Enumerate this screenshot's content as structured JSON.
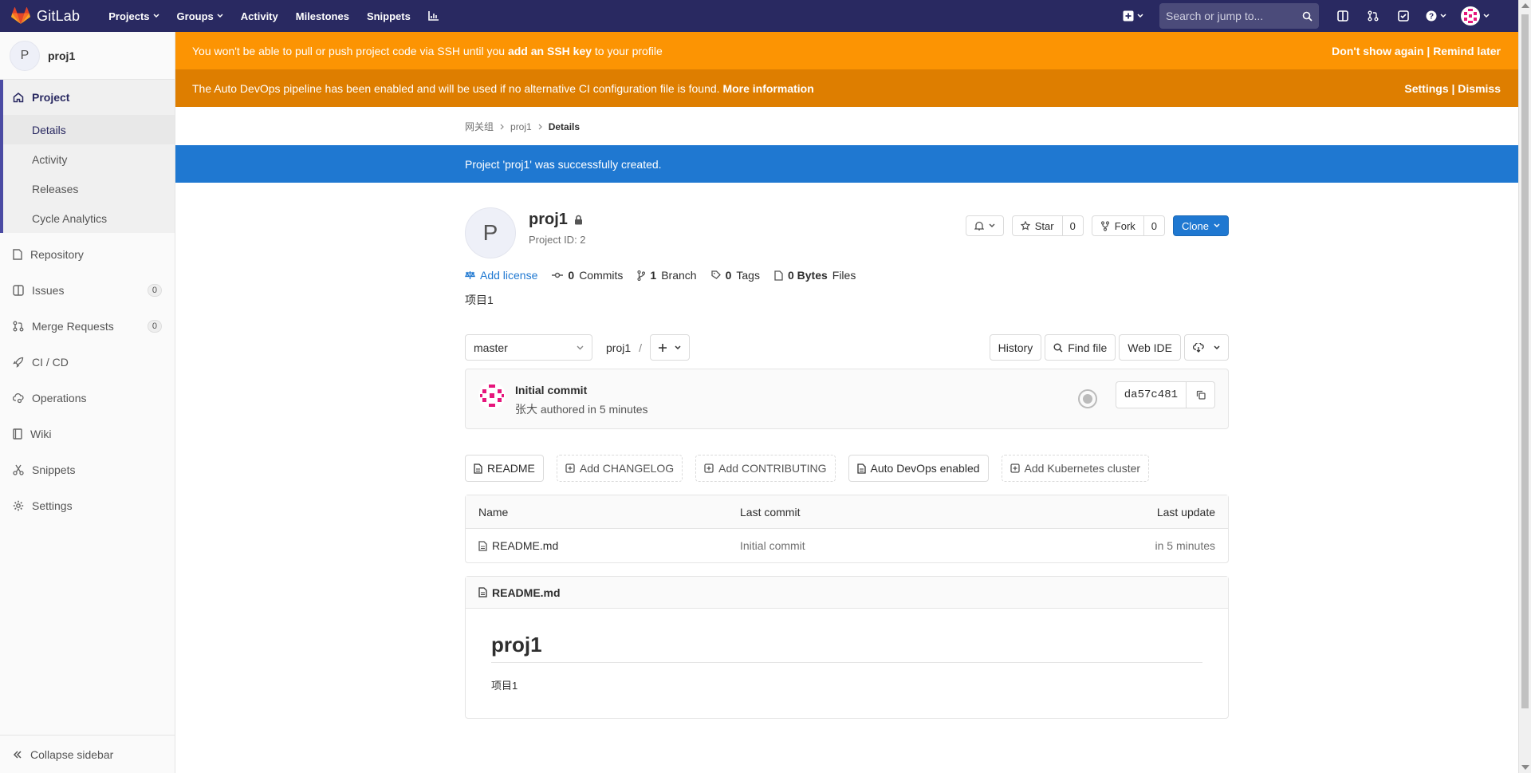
{
  "topnav": {
    "logo_text": "GitLab",
    "links": [
      "Projects",
      "Groups",
      "Activity",
      "Milestones",
      "Snippets"
    ],
    "search_placeholder": "Search or jump to..."
  },
  "sidebar": {
    "project_initial": "P",
    "project_name": "proj1",
    "section": "Project",
    "sub_items": [
      "Details",
      "Activity",
      "Releases",
      "Cycle Analytics"
    ],
    "items": [
      {
        "label": "Repository"
      },
      {
        "label": "Issues",
        "count": "0"
      },
      {
        "label": "Merge Requests",
        "count": "0"
      },
      {
        "label": "CI / CD"
      },
      {
        "label": "Operations"
      },
      {
        "label": "Wiki"
      },
      {
        "label": "Snippets"
      },
      {
        "label": "Settings"
      }
    ],
    "collapse_label": "Collapse sidebar"
  },
  "banners": {
    "ssh_pre": "You won't be able to pull or push project code via SSH until you",
    "ssh_link": "add an SSH key",
    "ssh_post": "to your profile",
    "ssh_right": "Don't show again | Remind later",
    "devops_text": "The Auto DevOps pipeline has been enabled and will be used if no alternative CI configuration file is found.",
    "devops_link": "More information",
    "devops_right": "Settings | Dismiss"
  },
  "breadcrumbs": [
    "网关组",
    "proj1",
    "Details"
  ],
  "flash": "Project 'proj1' was successfully created.",
  "project": {
    "initial": "P",
    "name": "proj1",
    "id_text": "Project ID: 2",
    "star_label": "Star",
    "star_count": "0",
    "fork_label": "Fork",
    "fork_count": "0",
    "clone_label": "Clone",
    "description": "项目1"
  },
  "stats": {
    "license": "Add license",
    "commits_n": "0",
    "commits_l": "Commits",
    "branch_n": "1",
    "branch_l": "Branch",
    "tags_n": "0",
    "tags_l": "Tags",
    "files_n": "0 Bytes",
    "files_l": "Files"
  },
  "toolbar": {
    "branch": "master",
    "path": "proj1",
    "sep": "/",
    "history": "History",
    "find_file": "Find file",
    "web_ide": "Web IDE"
  },
  "commit": {
    "title": "Initial commit",
    "meta": "张大 authored in 5 minutes",
    "sha": "da57c481"
  },
  "quick_actions": [
    "README",
    "Add CHANGELOG",
    "Add CONTRIBUTING",
    "Auto DevOps enabled",
    "Add Kubernetes cluster"
  ],
  "file_table": {
    "headers": [
      "Name",
      "Last commit",
      "Last update"
    ],
    "rows": [
      {
        "name": "README.md",
        "commit": "Initial commit",
        "updated": "in 5 minutes"
      }
    ]
  },
  "readme": {
    "file": "README.md",
    "h1": "proj1",
    "p": "项目1"
  },
  "colors": {
    "nav": "#292961",
    "ssh_banner": "#fc9403",
    "devops_banner": "#de7e00",
    "flash": "#1f78d1",
    "link": "#1f78d1"
  }
}
